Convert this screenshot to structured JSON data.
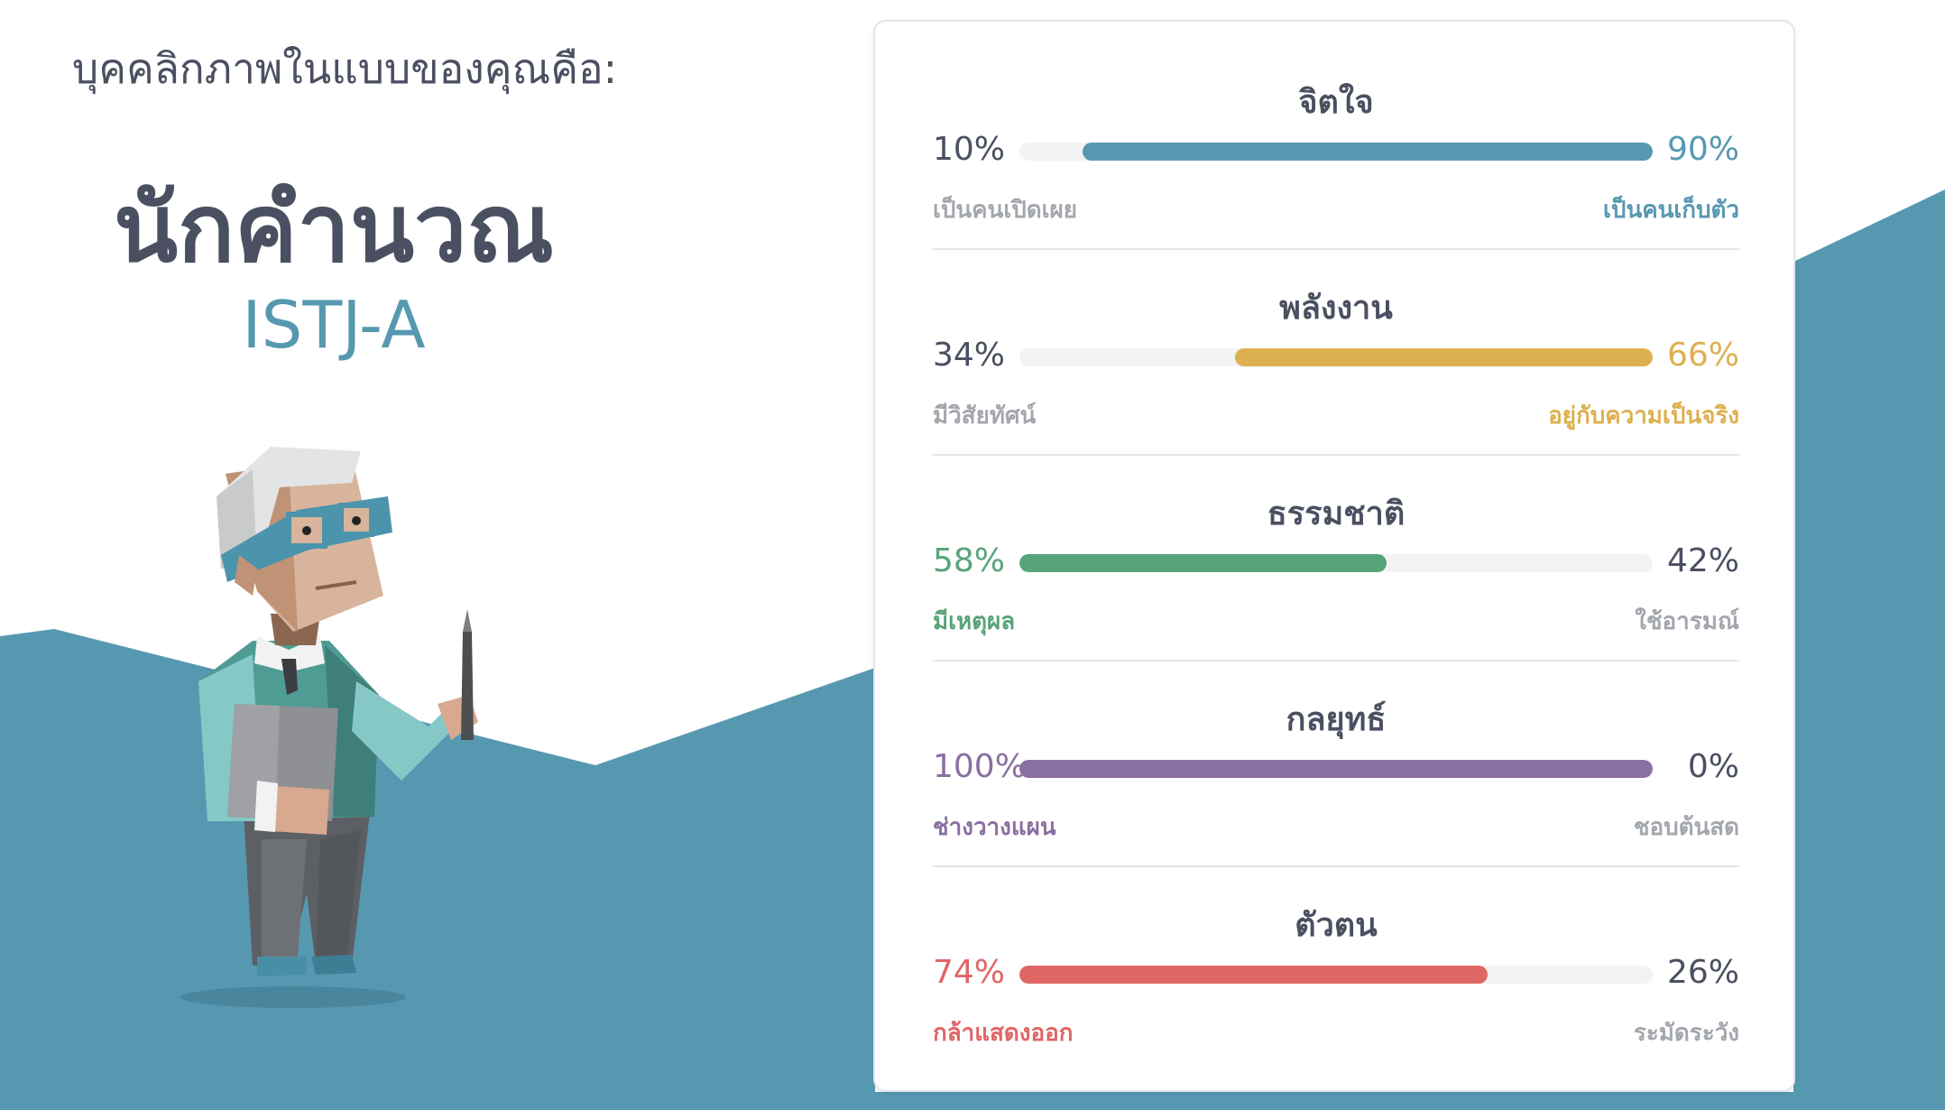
{
  "header": {
    "intro": "บุคคลิกภาพในแบบของคุณคือ:",
    "type_name": "นักคำนวณ",
    "type_code": "ISTJ-A"
  },
  "colors": {
    "background_blue": "#5798b1",
    "text_dark": "#4a5061",
    "muted": "#a3a7ad"
  },
  "traits": [
    {
      "title": "จิตใจ",
      "left_pct": "10%",
      "right_pct": "90%",
      "left_label": "เป็นคนเปิดเผย",
      "right_label": "เป็นคนเก็บตัว",
      "dominant": "right",
      "dominant_value": 90,
      "color": "#5798b1"
    },
    {
      "title": "พลังงาน",
      "left_pct": "34%",
      "right_pct": "66%",
      "left_label": "มีวิสัยทัศน์",
      "right_label": "อยู่กับความเป็นจริง",
      "dominant": "right",
      "dominant_value": 66,
      "color": "#ddb04f"
    },
    {
      "title": "ธรรมชาติ",
      "left_pct": "58%",
      "right_pct": "42%",
      "left_label": "มีเหตุผล",
      "right_label": "ใช้อารมณ์",
      "dominant": "left",
      "dominant_value": 58,
      "color": "#58a47a"
    },
    {
      "title": "กลยุทธ์",
      "left_pct": "100%",
      "right_pct": "0%",
      "left_label": "ช่างวางแผน",
      "right_label": "ชอบต้นสด",
      "dominant": "left",
      "dominant_value": 100,
      "color": "#8a6fa1"
    },
    {
      "title": "ตัวตน",
      "left_pct": "74%",
      "right_pct": "26%",
      "left_label": "กล้าแสดงออก",
      "right_label": "ระมัดระวัง",
      "dominant": "left",
      "dominant_value": 74,
      "color": "#e06565"
    }
  ]
}
